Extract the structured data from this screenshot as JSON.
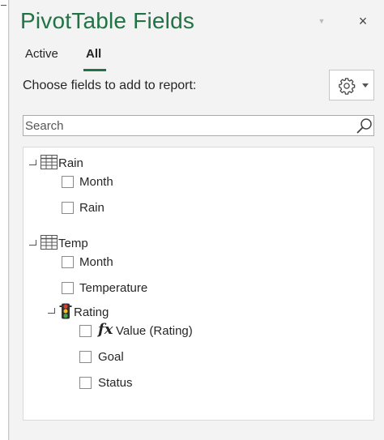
{
  "panel": {
    "title": "PivotTable Fields",
    "title_dropdown_icon": "chevron-down-icon",
    "close_icon": "close-icon",
    "close_glyph": "×",
    "accent_color": "#217346"
  },
  "tabs": [
    {
      "label": "Active",
      "selected": false
    },
    {
      "label": "All",
      "selected": true
    }
  ],
  "choose_label": "Choose fields to add to report:",
  "tools_button": {
    "icon": "gear-icon",
    "dropdown_icon": "chevron-down-icon"
  },
  "search": {
    "placeholder": "Search",
    "value": "",
    "icon": "search-icon"
  },
  "field_tree": [
    {
      "table": "Rain",
      "icon": "table-icon",
      "expanded": true,
      "fields": [
        {
          "label": "Month",
          "checked": false
        },
        {
          "label": "Rain",
          "checked": false
        }
      ]
    },
    {
      "table": "Temp",
      "icon": "table-icon",
      "expanded": true,
      "fields": [
        {
          "label": "Month",
          "checked": false
        },
        {
          "label": "Temperature",
          "checked": false
        }
      ],
      "kpis": [
        {
          "label": "Rating",
          "icon": "traffic-light-icon",
          "expanded": true,
          "fields": [
            {
              "label": "Value (Rating)",
              "icon": "fx-icon",
              "checked": false
            },
            {
              "label": "Goal",
              "checked": false
            },
            {
              "label": "Status",
              "checked": false
            }
          ]
        }
      ]
    }
  ]
}
